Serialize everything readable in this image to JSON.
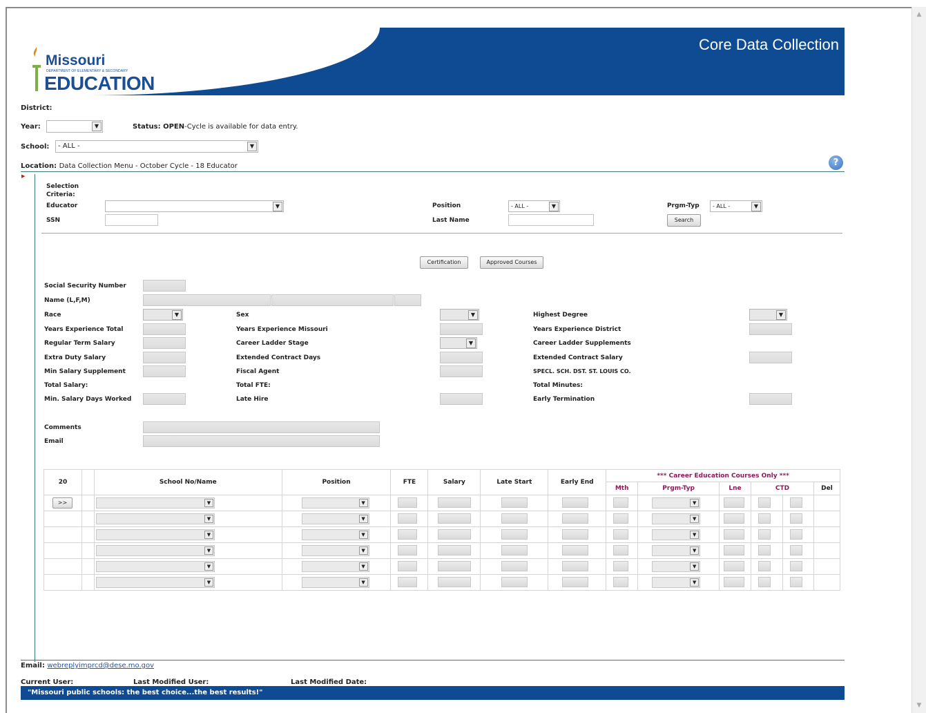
{
  "header": {
    "app_title": "Core Data Collection",
    "logo_top": "Missouri",
    "logo_dept": "DEPARTMENT OF ELEMENTARY & SECONDARY",
    "logo_bottom": "EDUCATION"
  },
  "top": {
    "district_label": "District:",
    "year_label": "Year:",
    "year_value": "",
    "status_label": "Status:",
    "status_value": "OPEN",
    "status_text": "-Cycle is available for data entry.",
    "school_label": "School:",
    "school_value": "- ALL -",
    "location_label": "Location:",
    "location_value": "Data Collection Menu - October Cycle - 18 Educator"
  },
  "criteria": {
    "title1": "Selection",
    "title2": "Criteria:",
    "educator_label": "Educator",
    "ssn_label": "SSN",
    "position_label": "Position",
    "position_value": "- ALL -",
    "last_name_label": "Last Name",
    "prgm_label": "Prgm-Typ",
    "prgm_value": "- ALL -",
    "search_button": "Search"
  },
  "buttons": {
    "certification": "Certification",
    "approved_courses": "Approved Courses"
  },
  "fields": {
    "ssn": "Social Security Number",
    "name": "Name (L,F,M)",
    "race": "Race",
    "sex": "Sex",
    "highest_degree": "Highest Degree",
    "yrs_total": "Years Experience Total",
    "yrs_missouri": "Years Experience Missouri",
    "yrs_district": "Years Experience District",
    "regular_salary": "Regular Term Salary",
    "career_stage": "Career Ladder Stage",
    "career_supp": "Career Ladder Supplements",
    "extra_duty": "Extra Duty Salary",
    "ext_days": "Extended Contract Days",
    "ext_salary": "Extended Contract Salary",
    "min_supp": "Min Salary Supplement",
    "fiscal_agent": "Fiscal Agent",
    "specl": "SPECL. SCH. DST. ST. LOUIS CO.",
    "total_salary": "Total Salary:",
    "total_fte": "Total FTE:",
    "total_minutes": "Total Minutes:",
    "min_days": "Min. Salary Days Worked",
    "late_hire": "Late Hire",
    "early_term": "Early Termination",
    "comments": "Comments",
    "email": "Email"
  },
  "table": {
    "count": "20",
    "school_col": "School No/Name",
    "position_col": "Position",
    "fte_col": "FTE",
    "salary_col": "Salary",
    "late_start_col": "Late Start",
    "early_end_col": "Early End",
    "career_header": "*** Career Education Courses Only ***",
    "mth_col": "Mth",
    "prgm_col": "Prgm-Typ",
    "lne_col": "Lne",
    "ctd_col": "CTD",
    "del_col": "Del",
    "row_button": ">>"
  },
  "footer": {
    "email_label": "Email:",
    "email_value": "webreplyimprcd@dese.mo.gov",
    "current_user_label": "Current User:",
    "last_mod_user_label": "Last Modified User:",
    "last_mod_date_label": "Last Modified Date:",
    "slogan": "\"Missouri public schools: the best choice...the best results!\""
  },
  "colors": {
    "brand_blue": "#0e4b92",
    "accent_purple": "#8b1a55"
  }
}
